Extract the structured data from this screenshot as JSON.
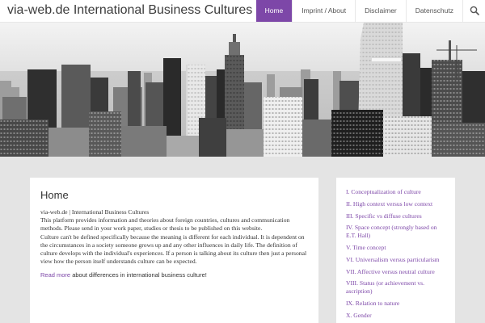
{
  "header": {
    "site_title": "via-web.de International Business Cultures",
    "nav": [
      {
        "label": "Home",
        "active": true
      },
      {
        "label": "Imprint / About",
        "active": false
      },
      {
        "label": "Disclaimer",
        "active": false
      },
      {
        "label": "Datenschutz",
        "active": false
      }
    ],
    "search_icon": "search-icon"
  },
  "hero": {
    "image": "city-skyline-photo"
  },
  "main": {
    "title": "Home",
    "intro_title": "via-web.de | International Business Cultures",
    "paragraph1": "This platform provides information and theories about foreign countries, cultures and communication methods. Please send in your work paper, studies or thesis to be published on this website.",
    "paragraph2": "Culture can't be defined specifically because the meaning is different for each individual. It is dependent on the circumstances in a society someone grows up and any other influences in daily life. The definition of culture develops with the individual's experiences. If a person is talking about its culture then just a personal view how the person itself understands culture can be expected.",
    "read_more": "Read more",
    "read_more_tail": " about differences in international business culture!"
  },
  "sidebar": {
    "items": [
      "I. Conceptualization of culture",
      "II. High context versus low context",
      "III. Specific vs diffuse cultures",
      "IV. Space concept (strongly based on E.T. Hall)",
      "V. Time concept",
      "VI. Universalism versus particularism",
      "VII. Affective versus neutral culture",
      "VIII. Status (or achievement vs. ascription)",
      "IX. Relation to nature",
      "X. Gender"
    ]
  },
  "colors": {
    "accent": "#7d47a8",
    "background": "#e4e4e4"
  }
}
